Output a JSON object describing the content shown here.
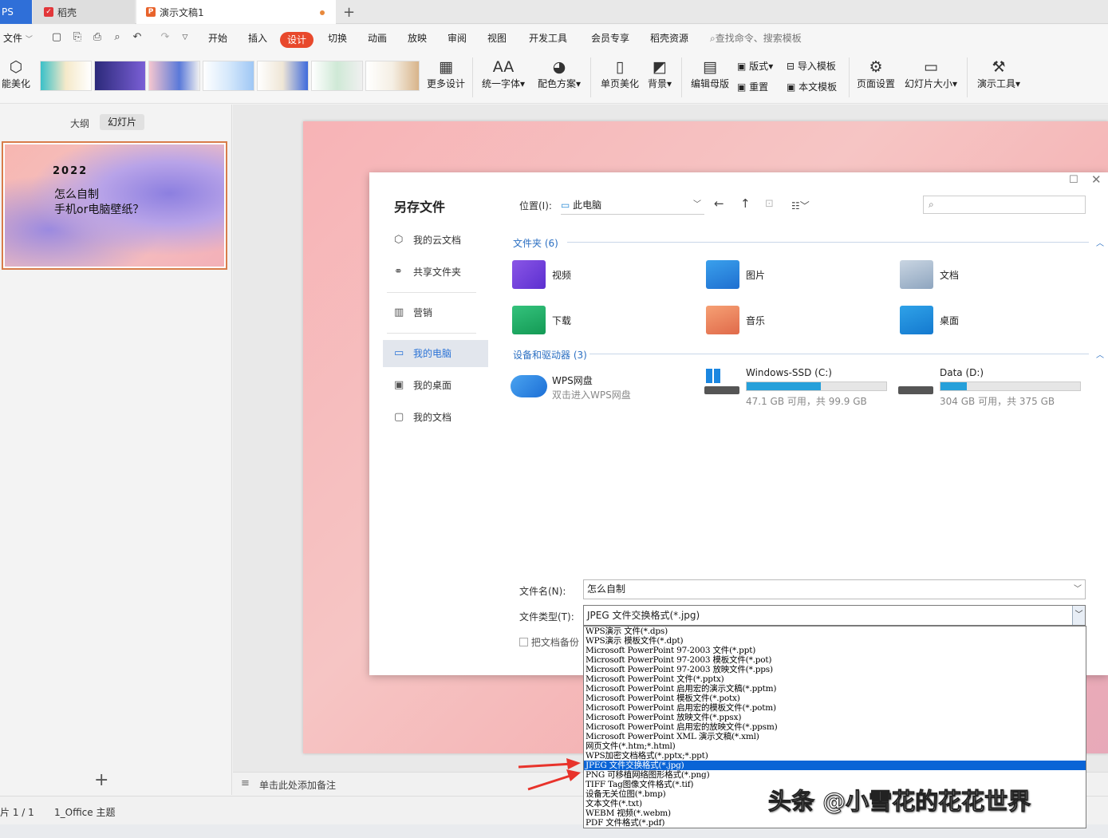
{
  "tabs": [
    {
      "label": "PS"
    },
    {
      "label": "稻壳"
    },
    {
      "label": "演示文稿1"
    }
  ],
  "new_tab_symbol": "+",
  "menu": {
    "file": "文件",
    "items": [
      "开始",
      "插入",
      "设计",
      "切换",
      "动画",
      "放映",
      "审阅",
      "视图",
      "开发工具",
      "会员专享",
      "稻壳资源"
    ],
    "search_placeholder": "查找命令、搜索模板"
  },
  "ribbon": {
    "smart_beautify": "能美化",
    "more_designs": "更多设计",
    "unify_font": "统一字体",
    "color_scheme": "配色方案",
    "single_page_beautify": "单页美化",
    "background": "背景",
    "edit_master": "编辑母版",
    "layout": "版式",
    "reset": "重置",
    "import_template": "导入模板",
    "this_template": "本文模板",
    "page_setup": "页面设置",
    "slide_size": "幻灯片大小",
    "presentation_tools": "演示工具"
  },
  "left_pane": {
    "tab_outline": "大纲",
    "tab_slides": "幻灯片",
    "thumb_year": "2022",
    "thumb_line1": "怎么自制",
    "thumb_line2": "手机or电脑壁纸？",
    "add_slide": "+"
  },
  "notes_placeholder": "单击此处添加备注",
  "status": {
    "slide_count": "片 1 / 1",
    "theme": "1_Office 主题"
  },
  "dialog": {
    "title": "另存文件",
    "location_label": "位置(I):",
    "location_value": "此电脑",
    "sidebar": [
      "我的云文档",
      "共享文件夹",
      "营销",
      "我的电脑",
      "我的桌面",
      "我的文档"
    ],
    "folders_header": "文件夹 (6)",
    "folders": [
      "视频",
      "图片",
      "文档",
      "下载",
      "音乐",
      "桌面"
    ],
    "devices_header": "设备和驱动器 (3)",
    "wps_disk": {
      "name": "WPS网盘",
      "sub": "双击进入WPS网盘"
    },
    "drives": [
      {
        "name": "Windows-SSD (C:)",
        "info": "47.1 GB 可用，共 99.9 GB",
        "used_fraction": 0.53
      },
      {
        "name": "Data (D:)",
        "info": "304 GB 可用，共 375 GB",
        "used_fraction": 0.19
      }
    ],
    "filename_label": "文件名(N):",
    "filename_value": "怎么自制",
    "filetype_label": "文件类型(T):",
    "filetype_value": "JPEG 文件交换格式(*.jpg)",
    "backup_label": "把文档备份"
  },
  "file_types": [
    "WPS演示 文件(*.dps)",
    "WPS演示 模板文件(*.dpt)",
    "Microsoft PowerPoint 97-2003 文件(*.ppt)",
    "Microsoft PowerPoint 97-2003 模板文件(*.pot)",
    "Microsoft PowerPoint 97-2003 放映文件(*.pps)",
    "Microsoft PowerPoint 文件(*.pptx)",
    "Microsoft PowerPoint 启用宏的演示文稿(*.pptm)",
    "Microsoft PowerPoint 模板文件(*.potx)",
    "Microsoft PowerPoint 启用宏的模板文件(*.potm)",
    "Microsoft PowerPoint 放映文件(*.ppsx)",
    "Microsoft PowerPoint 启用宏的放映文件(*.ppsm)",
    "Microsoft PowerPoint XML 演示文稿(*.xml)",
    "网页文件(*.htm;*.html)",
    "WPS加密文档格式(*.pptx;*.ppt)",
    "JPEG 文件交换格式(*.jpg)",
    "PNG 可移植网络图形格式(*.png)",
    "TIFF Tag图像文件格式(*.tif)",
    "设备无关位图(*.bmp)",
    "文本文件(*.txt)",
    "WEBM 视频(*.webm)",
    "PDF 文件格式(*.pdf)"
  ],
  "selected_index": 14,
  "watermark": "头条 @小雪花的花花世界",
  "colors": {
    "accent": "#e8492c",
    "selection": "#0a64d6",
    "arrow": "#e8332b"
  }
}
